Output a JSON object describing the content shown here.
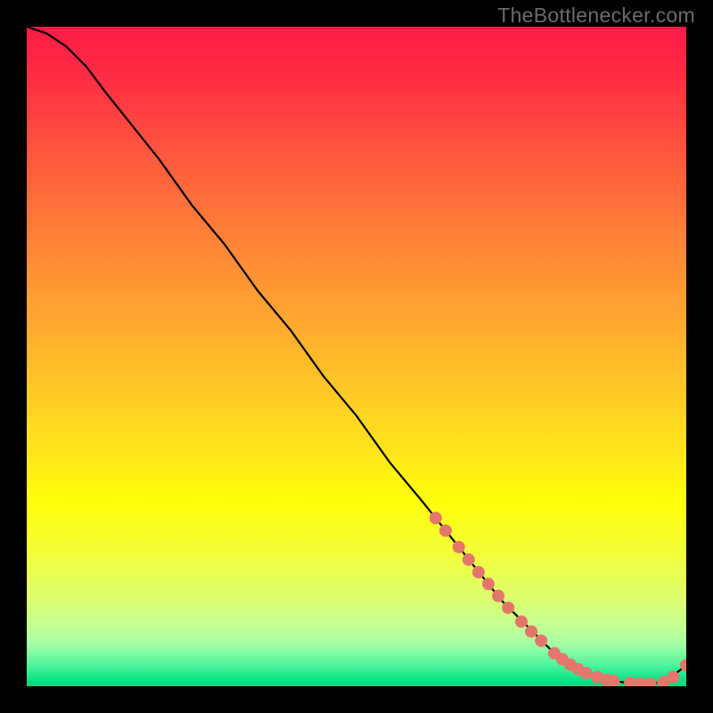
{
  "watermark": "TheBottlenecker.com",
  "chart_data": {
    "type": "line",
    "title": "",
    "xlabel": "",
    "ylabel": "",
    "xlim": [
      0,
      100
    ],
    "ylim": [
      0,
      100
    ],
    "background_gradient": {
      "stops": [
        {
          "offset": 0,
          "color": "#ff1a47"
        },
        {
          "offset": 0.08,
          "color": "#ff2e44"
        },
        {
          "offset": 0.2,
          "color": "#ff5a3e"
        },
        {
          "offset": 0.35,
          "color": "#ff8b36"
        },
        {
          "offset": 0.5,
          "color": "#ffb82b"
        },
        {
          "offset": 0.63,
          "color": "#ffe11d"
        },
        {
          "offset": 0.72,
          "color": "#ffff0a"
        },
        {
          "offset": 0.8,
          "color": "#f3ff3a"
        },
        {
          "offset": 0.86,
          "color": "#dfff6a"
        },
        {
          "offset": 0.905,
          "color": "#c9ff8f"
        },
        {
          "offset": 0.935,
          "color": "#a6ffa6"
        },
        {
          "offset": 0.965,
          "color": "#57f59e"
        },
        {
          "offset": 0.985,
          "color": "#1be78c"
        },
        {
          "offset": 1.0,
          "color": "#07d67a"
        }
      ]
    },
    "series": [
      {
        "name": "bottleneck-curve",
        "color": "#000000",
        "x": [
          0,
          3,
          6,
          9,
          12,
          16,
          20,
          25,
          30,
          35,
          40,
          45,
          50,
          55,
          60,
          64,
          68,
          72,
          76,
          80,
          83,
          86,
          89,
          92,
          95,
          97,
          98,
          100
        ],
        "y": [
          100,
          99,
          97,
          94,
          90,
          85,
          80,
          73,
          67,
          60,
          54,
          47,
          41,
          34,
          28,
          23,
          18,
          13,
          9,
          5,
          3,
          1.6,
          0.8,
          0.4,
          0.4,
          0.8,
          1.6,
          3.2
        ]
      }
    ],
    "markers": {
      "name": "highlight-dots",
      "color": "#e3776b",
      "radius_px": 7,
      "x": [
        62,
        63.5,
        65.5,
        67,
        68.5,
        70,
        71.5,
        73,
        75,
        76.5,
        78,
        80,
        81.2,
        82.4,
        83.6,
        84.8,
        86.5,
        88,
        89,
        91.5,
        93,
        94.5,
        96.5,
        98,
        100
      ],
      "y": [
        25.5,
        23.6,
        21.1,
        19.2,
        17.3,
        15.5,
        13.7,
        11.9,
        9.8,
        8.3,
        6.9,
        5.0,
        4.1,
        3.3,
        2.6,
        2.0,
        1.4,
        1.0,
        0.8,
        0.5,
        0.4,
        0.4,
        0.6,
        1.4,
        3.2
      ]
    }
  }
}
